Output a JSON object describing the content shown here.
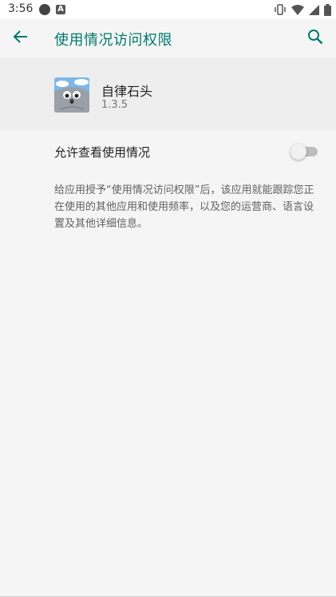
{
  "status_bar": {
    "time": "3:56",
    "notification_letter": "A"
  },
  "app_bar": {
    "title": "使用情况访问权限"
  },
  "app_info": {
    "name": "自律石头",
    "version": "1.3.5"
  },
  "permission": {
    "label": "允许查看使用情况",
    "enabled": false
  },
  "description": "给应用授予“使用情况访问权限”后，该应用就能跟踪您正在使用的其他应用和使用频率，以及您的运营商、语言设置及其他详细信息。",
  "colors": {
    "accent": "#00796b",
    "background": "#f5f5f5",
    "header_background": "#eeeeee"
  }
}
